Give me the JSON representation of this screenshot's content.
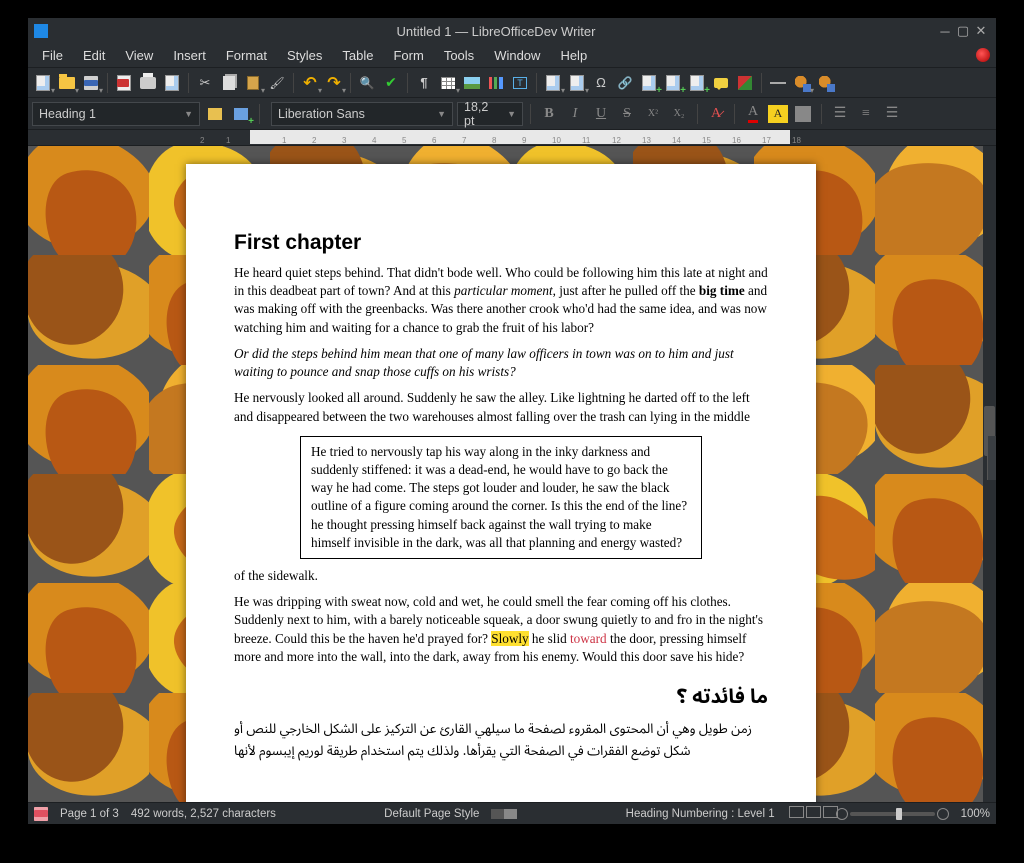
{
  "window": {
    "title": "Untitled 1 — LibreOfficeDev Writer"
  },
  "menu": [
    "File",
    "Edit",
    "View",
    "Insert",
    "Format",
    "Styles",
    "Table",
    "Form",
    "Tools",
    "Window",
    "Help"
  ],
  "style_combo": "Heading 1",
  "font_combo": "Liberation Sans",
  "size_combo": "18,2 pt",
  "ruler_numbers": [
    "2",
    "1",
    "1",
    "2",
    "3",
    "4",
    "5",
    "6",
    "7",
    "8",
    "9",
    "10",
    "11",
    "12",
    "13",
    "14",
    "15",
    "16",
    "17",
    "18"
  ],
  "doc": {
    "h1": "First chapter",
    "p1a": "He heard quiet steps behind. That didn't bode well. Who could be following him this late at night and in this deadbeat part of town? And at this ",
    "p1_em": "particular moment",
    "p1b": ", just after he pulled off the ",
    "p1_strong": "big time",
    "p1c": " and was making off with the greenbacks. Was there another crook who'd had the same idea, and was now watching him and waiting for a chance to grab the fruit of his labor?",
    "p2": "Or did the steps behind him mean that one of many law officers in town was on to him and just waiting to pounce and snap those cuffs on his wrists?",
    "p3": "He nervously looked all around. Suddenly he saw the alley. Like lightning he darted off to the left and disappeared between the two warehouses almost falling over the trash can lying in the middle",
    "box": "He tried to nervously tap his way along in the inky darkness and suddenly stiffened: it was a dead-end, he would have to go back the way he had come. The steps got louder and louder, he saw the black outline of a figure coming around the corner. Is this the end of the line? he thought pressing himself back against the wall trying to make himself invisible in the dark, was all that planning and energy wasted?",
    "p4": "of the sidewalk.",
    "p5a": "He was dripping with sweat now, cold and wet, he could smell the fear coming off his clothes. Suddenly next to him, with a barely noticeable squeak, a door swung quietly to and fro in the night's breeze. Could this be the haven he'd prayed for? ",
    "p5_hl": "Slowly",
    "p5b": " he slid ",
    "p5_red": "toward",
    "p5c": " the door, pressing himself more and more into the wall, into the dark, away from his enemy. Would this door save his hide?",
    "ar_h": "ما فائدته ؟",
    "ar_p": "زمن طويل وهي أن المحتوى المقروء لصفحة ما سيلهي القارئ عن التركيز على الشكل الخارجي للنص أو شكل توضع الفقرات في الصفحة التي يقرأها. ولذلك يتم استخدام طريقة لوريم إيبسوم لأنها"
  },
  "status": {
    "page": "Page 1 of 3",
    "words": "492 words, 2,527 characters",
    "pagestyle": "Default Page Style",
    "numbering": "Heading Numbering : Level 1",
    "zoom": "100%"
  }
}
